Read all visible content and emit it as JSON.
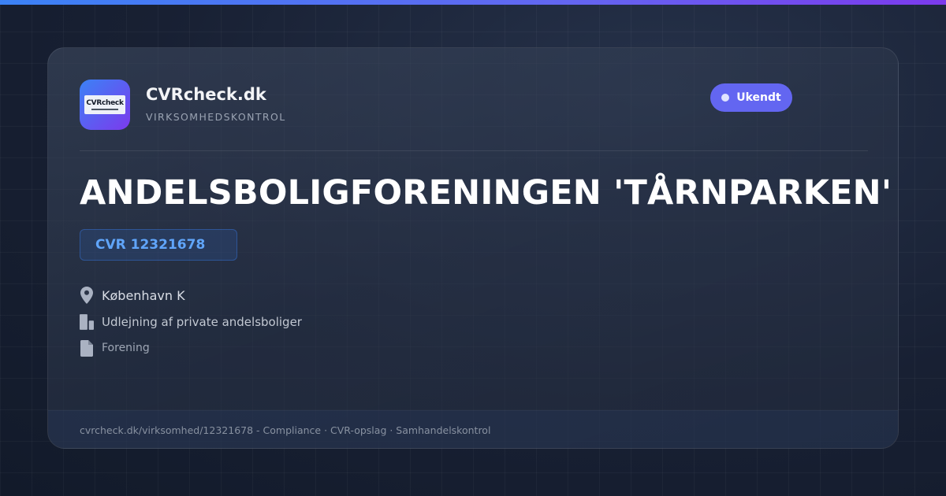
{
  "brand": {
    "logo_text": "CVRcheck",
    "name": "CVRcheck.dk",
    "tagline": "VIRKSOMHEDSKONTROL"
  },
  "status": {
    "label": "Ukendt",
    "color": "#6366f1"
  },
  "company": {
    "name": "ANDELSBOLIGFORENINGEN 'TÅRNPARKEN'",
    "cvr": "CVR 12321678",
    "location": "København K",
    "industry": "Udlejning af private andelsboliger",
    "type": "Forening"
  },
  "icons": {
    "location": "map-pin-icon",
    "industry": "building-icon",
    "type": "document-icon"
  },
  "footer": {
    "text": "cvrcheck.dk/virksomhed/12321678 - Compliance · CVR-opslag · Samhandelskontrol"
  },
  "colors": {
    "accent_blue": "#3b82f6",
    "accent_violet": "#7c3aed",
    "cvr_text": "#60a5fa"
  }
}
